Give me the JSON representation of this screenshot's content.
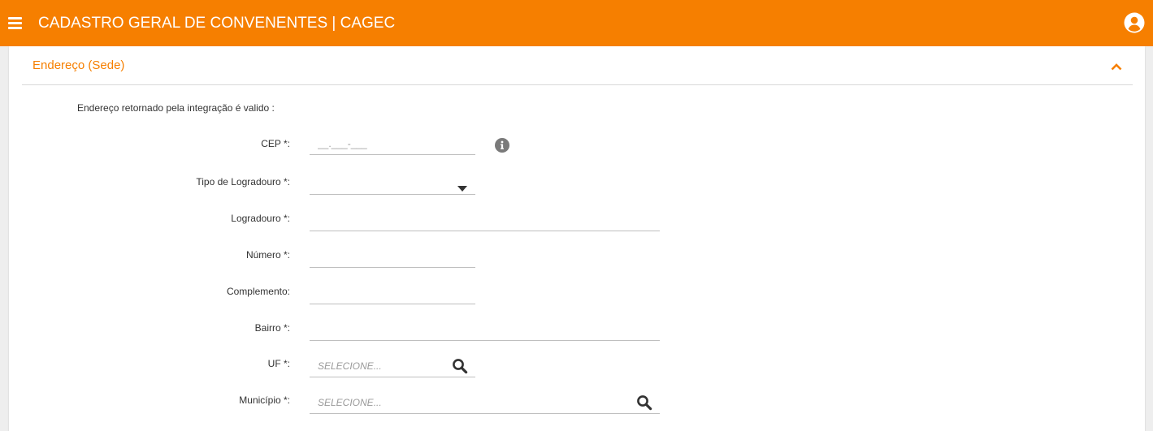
{
  "header": {
    "title": "CADASTRO GERAL DE CONVENENTES | CAGEC",
    "menu_icon": "hamburger-menu-icon",
    "user_icon": "user-account-icon"
  },
  "colors": {
    "brand": "#f67f00",
    "panel_bg": "#ffffff",
    "page_bg": "#eeeeee"
  },
  "panel": {
    "title": "Endereço (Sede)",
    "collapse_icon": "chevron-up-icon"
  },
  "form": {
    "address_valid_label": "Endereço retornado pela integração é valido :",
    "cep": {
      "label": "CEP *:",
      "placeholder": "__.___-___",
      "info_icon": "info-circle-icon"
    },
    "tipo_logradouro": {
      "label": "Tipo de Logradouro *:",
      "value": "",
      "icon": "caret-down-icon"
    },
    "logradouro": {
      "label": "Logradouro *:",
      "value": ""
    },
    "numero": {
      "label": "Número *:",
      "value": ""
    },
    "complemento": {
      "label": "Complemento:",
      "value": ""
    },
    "bairro": {
      "label": "Bairro *:",
      "value": ""
    },
    "uf": {
      "label": "UF *:",
      "placeholder": "SELECIONE...",
      "icon": "search-icon"
    },
    "municipio": {
      "label": "Município *:",
      "placeholder": "SELECIONE...",
      "icon": "search-icon"
    }
  }
}
